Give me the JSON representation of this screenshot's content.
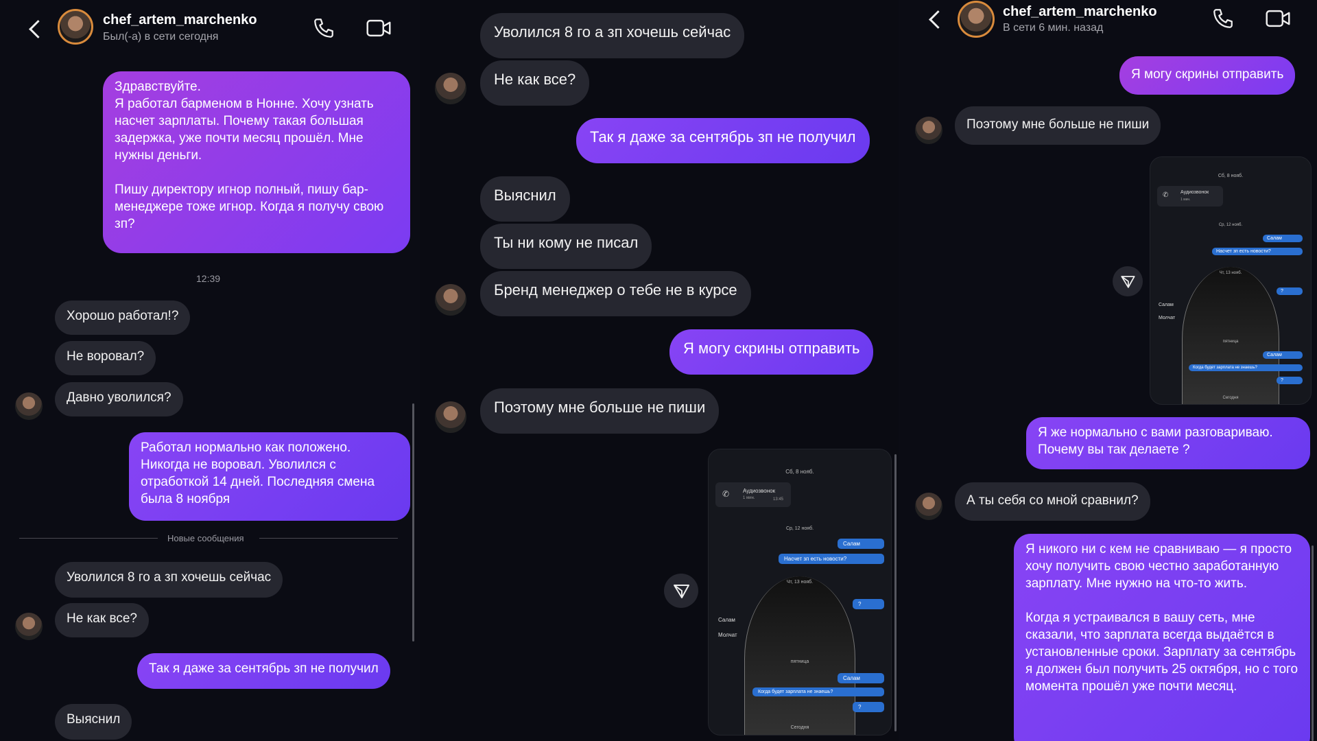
{
  "panel1": {
    "username": "chef_artem_marchenko",
    "status": "Был(-а) в сети сегодня",
    "msg_intro": "Здравствуйте.\nЯ работал барменом в Нонне. Хочу узнать насчет зарплаты. Почему такая большая задержка, уже почти месяц прошёл. Мне нужны деньги.\n\nПишу директору игнор полный, пишу бар-менеджере тоже игнор. Когда я получу свою зп?",
    "time": "12:39",
    "m1": "Хорошо работал!?",
    "m2": "Не воровал?",
    "m3": "Давно уволился?",
    "m4": "Работал нормально как положено. Никогда не воровал. Уволился с отработкой 14 дней. Последняя смена была 8 ноября",
    "new_messages": "Новые сообщения",
    "m5": "Уволился 8 го а зп хочешь сейчас",
    "m6": "Не как все?",
    "m7": "Так я даже за сентябрь зп не получил",
    "m8": "Выяснил"
  },
  "panel2": {
    "m1": "Уволился 8 го а зп хочешь сейчас",
    "m2": "Не как все?",
    "m3": "Так я даже за сентябрь зп не получил",
    "m4": "Выяснил",
    "m5": "Ты ни кому не писал",
    "m6": "Бренд менеджер о тебе не в курсе",
    "m7": "Я могу скрины отправить",
    "m8": "Поэтому мне больше не пиши",
    "shot": {
      "date1": "Сб, 8 нояб.",
      "call": "Аудиозвонок",
      "call_sub": "1 мин.",
      "call_time": "13:45",
      "date2": "Ср, 12 нояб.",
      "b1": "Салам",
      "b2": "Насчет зп есть новости?",
      "date3": "Чт, 13 нояб.",
      "b3": "?",
      "i1": "Салам",
      "i2": "Молчат",
      "date4": "пятница",
      "b4": "Салам",
      "b5": "Когда будет зарплата не знаешь?",
      "b6": "?",
      "today": "Сегодня"
    }
  },
  "panel3": {
    "username": "chef_artem_marchenko",
    "status": "В сети 6 мин. назад",
    "m1": "Я могу скрины отправить",
    "m2": "Поэтому мне больше не пиши",
    "m3": "Я же нормально с вами разговариваю. Почему вы так делаете ?",
    "m4": "А ты себя со мной сравнил?",
    "m5": "Я никого ни с кем не сравниваю — я просто хочу получить свою честно заработанную зарплату. Мне нужно на что-то жить.\n\nКогда я устраивался в вашу сеть, мне сказали, что зарплата всегда выдаётся в установленные сроки. Зарплату за сентябрь я должен был получить 25 октября, но с того момента прошёл уже почти месяц."
  },
  "colors": {
    "outgoing_start": "#a53ee0",
    "outgoing_end": "#7b3cf2",
    "incoming": "#262730",
    "background": "#0b0c14"
  },
  "icons": [
    "back-arrow-icon",
    "phone-icon",
    "video-camera-icon",
    "share-icon"
  ]
}
